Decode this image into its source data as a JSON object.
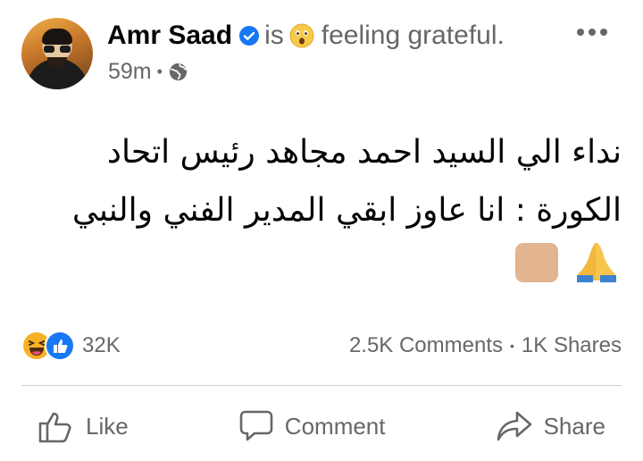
{
  "post": {
    "author_name": "Amr Saad",
    "verified_icon": "verified-badge-icon",
    "is_text": "is",
    "feeling_emoji": "😲",
    "feeling_text": "feeling grateful.",
    "time": "59m",
    "audience_icon": "globe-icon",
    "body_text": "نداء الي السيد احمد مجاهد رئيس اتحاد الكورة : انا عاوز ابقي المدير الفني والنبي",
    "body_emojis": [
      "🙏",
      "🏽"
    ]
  },
  "stats": {
    "reaction_icons": [
      "laughing-face-icon",
      "like-thumb-icon"
    ],
    "reaction_count": "32K",
    "comments": "2.5K Comments",
    "separator": "•",
    "shares": "1K Shares"
  },
  "actions": {
    "like": "Like",
    "comment": "Comment",
    "share": "Share"
  },
  "colors": {
    "brand_blue": "#1877f2",
    "secondary_text": "#65676b",
    "reaction_yellow": "#f7b125"
  }
}
